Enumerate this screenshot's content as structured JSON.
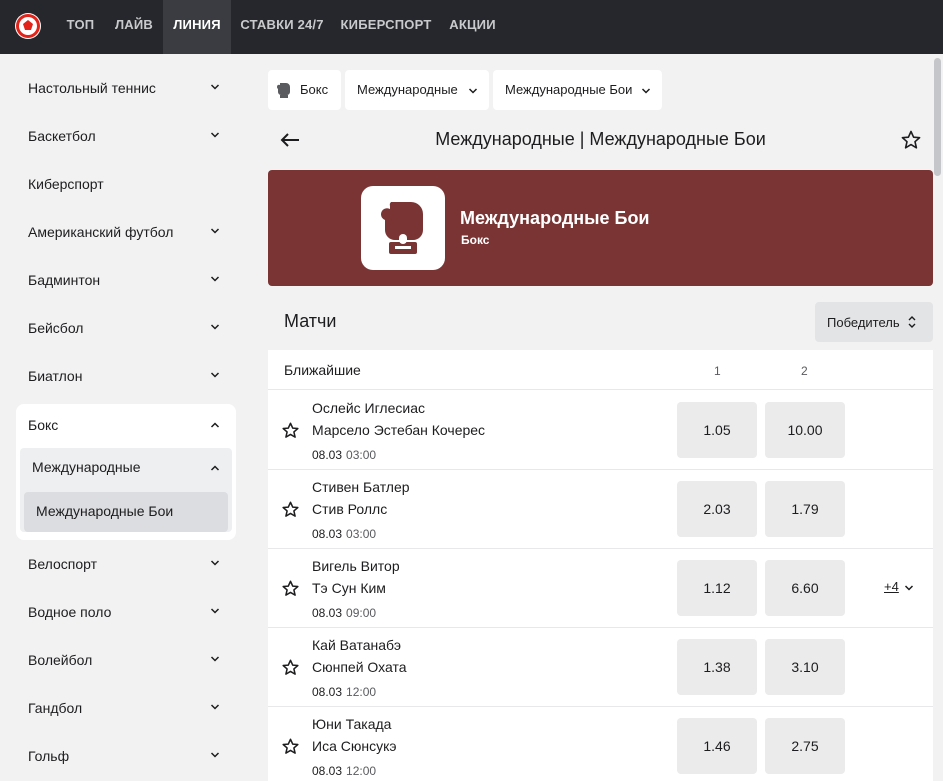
{
  "topnav": {
    "items": [
      {
        "label": "ТОП",
        "active": false
      },
      {
        "label": "ЛАЙВ",
        "active": false
      },
      {
        "label": "ЛИНИЯ",
        "active": true
      },
      {
        "label": "СТАВКИ 24/7",
        "active": false
      },
      {
        "label": "КИБЕРСПОРТ",
        "active": false
      },
      {
        "label": "АКЦИИ",
        "active": false
      }
    ]
  },
  "sidebar": {
    "items_top": [
      {
        "label": "Настольный теннис",
        "chevron": "chevron-down-icon"
      },
      {
        "label": "Баскетбол",
        "chevron": "chevron-down-icon"
      },
      {
        "label": "Киберспорт",
        "chevron": ""
      },
      {
        "label": "Американский футбол",
        "chevron": "chevron-down-icon"
      },
      {
        "label": "Бадминтон",
        "chevron": "chevron-down-icon"
      },
      {
        "label": "Бейсбол",
        "chevron": "chevron-down-icon"
      },
      {
        "label": "Биатлон",
        "chevron": "chevron-down-icon"
      }
    ],
    "expanded": {
      "label": "Бокс",
      "sub": {
        "label": "Международные",
        "sub": {
          "label": "Международные Бои"
        }
      }
    },
    "items_bottom": [
      {
        "label": "Велоспорт"
      },
      {
        "label": "Водное поло"
      },
      {
        "label": "Волейбол"
      },
      {
        "label": "Гандбол"
      },
      {
        "label": "Гольф"
      }
    ]
  },
  "breadcrumbs": {
    "sport": "Бокс",
    "country": "Международные",
    "league": "Международные Бои"
  },
  "page": {
    "title": "Международные | Международные Бои"
  },
  "banner": {
    "title": "Международные Бои",
    "subtitle": "Бокс",
    "bg_color": "#7a3434"
  },
  "matches": {
    "title": "Матчи",
    "market": "Победитель",
    "section_label": "Ближайшие",
    "col1": "1",
    "col2": "2",
    "rows": [
      {
        "player1": "Ослейс Иглесиас",
        "player2": "Марсело Эстебан Кочерес",
        "date": "08.03",
        "time": "03:00",
        "odd1": "1.05",
        "odd2": "10.00",
        "more": ""
      },
      {
        "player1": "Стивен Батлер",
        "player2": "Стив Роллс",
        "date": "08.03",
        "time": "03:00",
        "odd1": "2.03",
        "odd2": "1.79",
        "more": ""
      },
      {
        "player1": "Вигель Витор",
        "player2": "Тэ Сун Ким",
        "date": "08.03",
        "time": "09:00",
        "odd1": "1.12",
        "odd2": "6.60",
        "more": "+4"
      },
      {
        "player1": "Кай Ватанабэ",
        "player2": "Сюнпей Охата",
        "date": "08.03",
        "time": "12:00",
        "odd1": "1.38",
        "odd2": "3.10",
        "more": ""
      },
      {
        "player1": "Юни Такада",
        "player2": "Иса Сюнсукэ",
        "date": "08.03",
        "time": "12:00",
        "odd1": "1.46",
        "odd2": "2.75",
        "more": ""
      }
    ]
  },
  "colors": {
    "topbar": "#25272c",
    "accent_red": "#e2231a",
    "banner": "#7a3434"
  }
}
